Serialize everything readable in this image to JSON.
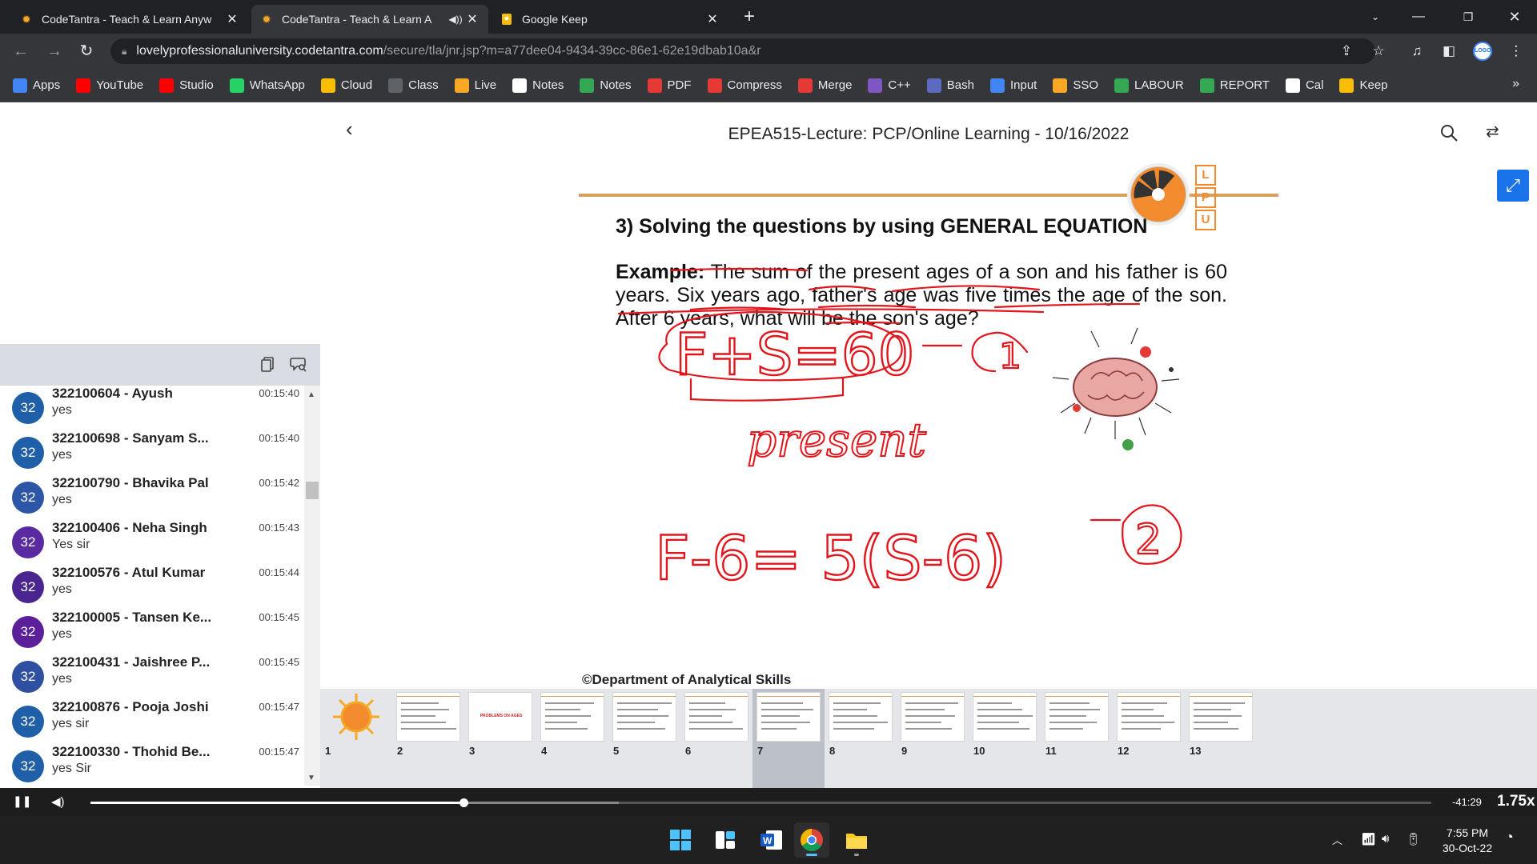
{
  "browser": {
    "tabs": [
      {
        "title": "CodeTantra - Teach & Learn Anyw",
        "active": false
      },
      {
        "title": "CodeTantra - Teach & Learn A",
        "active": true
      },
      {
        "title": "Google Keep",
        "active": false
      }
    ],
    "url_host": "lovelyprofessionaluniversity.codetantra.com",
    "url_path": "/secure/tla/jnr.jsp?m=a77dee04-9434-39cc-86e1-62e19dbab10a&r",
    "profile_text": "LOGO",
    "bookmarks": [
      {
        "label": "Apps",
        "icon": "apps-grid-icon",
        "color": "#4285f4"
      },
      {
        "label": "YouTube",
        "icon": "youtube-icon",
        "color": "#ff0000"
      },
      {
        "label": "Studio",
        "icon": "youtube-studio-icon",
        "color": "#ff0000"
      },
      {
        "label": "WhatsApp",
        "icon": "whatsapp-icon",
        "color": "#25d366"
      },
      {
        "label": "Cloud",
        "icon": "drive-icon",
        "color": "#fbbc04"
      },
      {
        "label": "Class",
        "icon": "class-icon",
        "color": "#5f6368"
      },
      {
        "label": "Live",
        "icon": "codetantra-icon",
        "color": "#f9a825"
      },
      {
        "label": "Notes",
        "icon": "notion-icon",
        "color": "#ffffff"
      },
      {
        "label": "Notes",
        "icon": "drive-icon",
        "color": "#34a853"
      },
      {
        "label": "PDF",
        "icon": "png-pdf-icon",
        "color": "#e53935"
      },
      {
        "label": "Compress",
        "icon": "heart-icon",
        "color": "#e53935"
      },
      {
        "label": "Merge",
        "icon": "heart-icon",
        "color": "#e53935"
      },
      {
        "label": "C++",
        "icon": "cpp-icon",
        "color": "#7e57c2"
      },
      {
        "label": "Bash",
        "icon": "bolt-icon",
        "color": "#5c6bc0"
      },
      {
        "label": "Input",
        "icon": "google-icon",
        "color": "#4285f4"
      },
      {
        "label": "SSO",
        "icon": "sso-icon",
        "color": "#f9a825"
      },
      {
        "label": "LABOUR",
        "icon": "plus-icon",
        "color": "#34a853"
      },
      {
        "label": "REPORT",
        "icon": "plus-icon",
        "color": "#34a853"
      },
      {
        "label": "Cal",
        "icon": "calculator-icon",
        "color": "#ffffff"
      },
      {
        "label": "Keep",
        "icon": "keep-icon",
        "color": "#fbbc04"
      }
    ]
  },
  "viewer": {
    "title": "EPEA515-Lecture: PCP/Online Learning - 10/16/2022"
  },
  "slide": {
    "lpu_letters": [
      "L",
      "P",
      "U"
    ],
    "heading": "3) Solving the questions by using GENERAL EQUATION",
    "example_label": "Example:",
    "example_text": " The sum of the present ages of a son and his father is 60 years. Six years ago, father's age was five times the age of the son. After 6 years, what will be the son's age?",
    "footer": "©Department of Analytical Skills",
    "ink": {
      "eq1": "F+S=60",
      "mark1": "1",
      "word": "present",
      "eq2": "F-6= 5(S-6)",
      "mark2": "2"
    }
  },
  "chat": {
    "messages": [
      {
        "name": "322100604 - Ayush",
        "time": "00:15:40",
        "text": "yes",
        "badge": "32",
        "color": "#1e5fa8"
      },
      {
        "name": "322100698 - Sanyam S...",
        "time": "00:15:40",
        "text": "yes",
        "badge": "32",
        "color": "#1e5fa8"
      },
      {
        "name": "322100790 - Bhavika Pal",
        "time": "00:15:42",
        "text": "yes",
        "badge": "32",
        "color": "#2d56a6"
      },
      {
        "name": "322100406 - Neha Singh",
        "time": "00:15:43",
        "text": "Yes sir",
        "badge": "32",
        "color": "#5a2aa0"
      },
      {
        "name": "322100576 - Atul Kumar",
        "time": "00:15:44",
        "text": "yes",
        "badge": "32",
        "color": "#4a2590"
      },
      {
        "name": "322100005 - Tansen Ke...",
        "time": "00:15:45",
        "text": "yes",
        "badge": "32",
        "color": "#5b1f99"
      },
      {
        "name": "322100431 - Jaishree P...",
        "time": "00:15:45",
        "text": "yes",
        "badge": "32",
        "color": "#2f4fa0"
      },
      {
        "name": "322100876 - Pooja Joshi",
        "time": "00:15:47",
        "text": "yes sir",
        "badge": "32",
        "color": "#1e5fa8"
      },
      {
        "name": "322100330 - Thohid Be...",
        "time": "00:15:47",
        "text": "yes Sir",
        "badge": "32",
        "color": "#1e5fa8"
      }
    ]
  },
  "thumbnails": {
    "pages": [
      "1",
      "2",
      "3",
      "4",
      "5",
      "6",
      "7",
      "8",
      "9",
      "10",
      "11",
      "12",
      "13"
    ],
    "selected_index": 6,
    "thumb3_text": "PROBLEMS ON AGES"
  },
  "player": {
    "remaining": "-41:29",
    "speed": "1.75x",
    "progress": 0.278,
    "buffered": 0.394
  },
  "taskbar": {
    "time": "7:55 PM",
    "date": "30-Oct-22"
  }
}
